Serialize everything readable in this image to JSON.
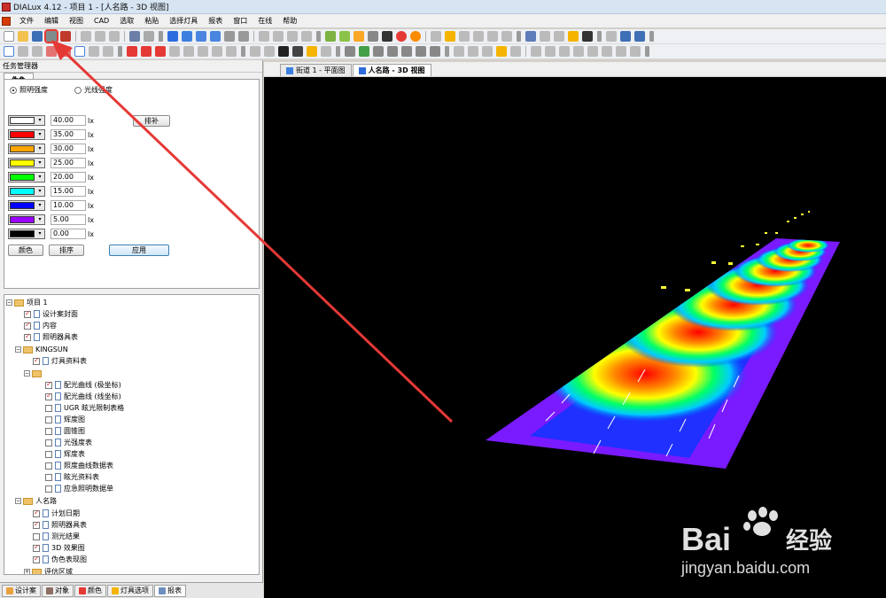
{
  "window": {
    "title": "DIALux 4.12 - 项目 1 - [人名路 - 3D 视图]"
  },
  "menu": [
    "文件",
    "编辑",
    "视图",
    "CAD",
    "选取",
    "粘贴",
    "选择灯具",
    "报表",
    "窗口",
    "在线",
    "帮助"
  ],
  "task_manager": {
    "title": "任务管理器",
    "tab": "伪色",
    "radio_illuminance": "照明强度",
    "radio_luminance": "光线强度",
    "fill_button": "排补",
    "legend": [
      {
        "color": "#ffffff",
        "value": "40.00",
        "unit": "lx"
      },
      {
        "color": "#ff0000",
        "value": "35.00",
        "unit": "lx"
      },
      {
        "color": "#ffa500",
        "value": "30.00",
        "unit": "lx"
      },
      {
        "color": "#ffff00",
        "value": "25.00",
        "unit": "lx"
      },
      {
        "color": "#00ff00",
        "value": "20.00",
        "unit": "lx"
      },
      {
        "color": "#00ffff",
        "value": "15.00",
        "unit": "lx"
      },
      {
        "color": "#0000ff",
        "value": "10.00",
        "unit": "lx"
      },
      {
        "color": "#9900ff",
        "value": "5.00",
        "unit": "lx"
      },
      {
        "color": "#000000",
        "value": "0.00",
        "unit": "lx"
      }
    ],
    "color_button": "颜色",
    "sort_button": "排序",
    "apply_button": "应用"
  },
  "tree": {
    "project": "项目 1",
    "items": [
      {
        "label": "设计案封面",
        "checked": true
      },
      {
        "label": "内容",
        "checked": true
      },
      {
        "label": "照明器具表",
        "checked": true
      }
    ],
    "kingsun": "KINGSUN",
    "kingsun_item": {
      "label": "灯具资料表",
      "checked": true
    },
    "sub_items": [
      {
        "label": "配光曲线 (极坐标)",
        "checked": true
      },
      {
        "label": "配光曲线 (线坐标)",
        "checked": true
      },
      {
        "label": "UGR 眩光限制表格",
        "checked": false
      },
      {
        "label": "辉度图",
        "checked": false
      },
      {
        "label": "圆锥图",
        "checked": false
      },
      {
        "label": "光强度表",
        "checked": false
      },
      {
        "label": "辉度表",
        "checked": false
      },
      {
        "label": "照度曲线数据表",
        "checked": false
      },
      {
        "label": "眩光资料表",
        "checked": false
      },
      {
        "label": "应急照明数据单",
        "checked": false
      }
    ],
    "road": "人名路",
    "road_items": [
      {
        "label": "计划日期",
        "checked": true
      },
      {
        "label": "照明器具表",
        "checked": true
      },
      {
        "label": "测光结果",
        "checked": false
      },
      {
        "label": "3D 效果图",
        "checked": true
      },
      {
        "label": "伪色表现图",
        "checked": true
      }
    ],
    "eval_area": "评估区域"
  },
  "bottom_tabs": [
    "设计案",
    "对象",
    "颜色",
    "灯具选项",
    "报表"
  ],
  "doc_tabs": [
    "街道 1 - 平面图",
    "人名路 - 3D 视图"
  ],
  "watermark": {
    "brand_left": "Bai",
    "brand_right": "经验",
    "url": "jingyan.baidu.com"
  }
}
